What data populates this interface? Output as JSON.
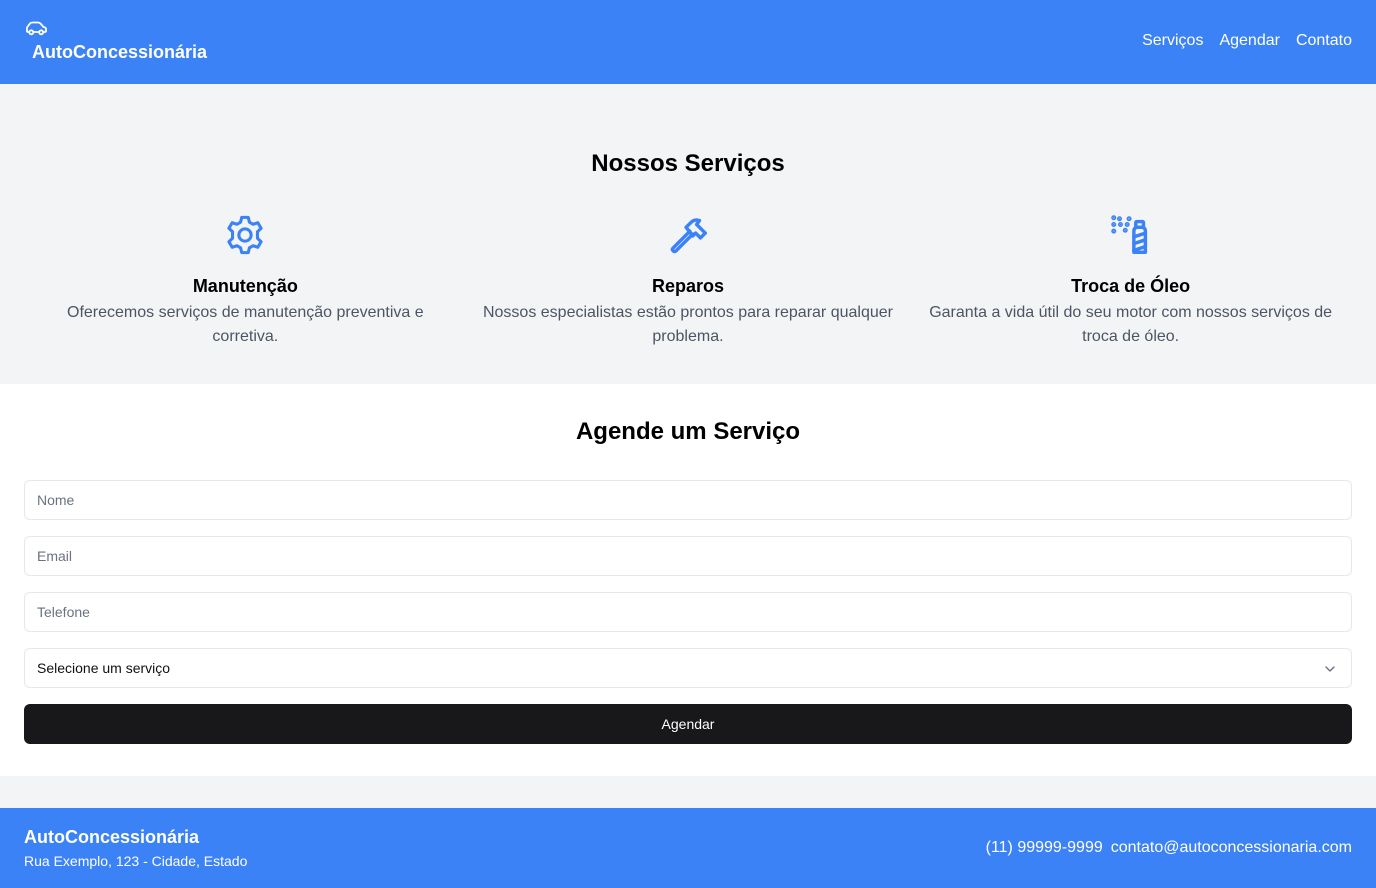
{
  "header": {
    "brand_icon": "car-icon",
    "brand_name": "AutoConcessionária",
    "nav": [
      "Serviços",
      "Agendar",
      "Contato"
    ]
  },
  "services": {
    "title": "Nossos Serviços",
    "items": [
      {
        "icon": "gear-icon",
        "title": "Manutenção",
        "description": "Oferecemos serviços de manutenção preventiva e corretiva."
      },
      {
        "icon": "hammer-icon",
        "title": "Reparos",
        "description": "Nossos especialistas estão prontos para reparar qualquer problema."
      },
      {
        "icon": "spray-can-icon",
        "title": "Troca de Óleo",
        "description": "Garanta a vida útil do seu motor com nossos serviços de troca de óleo."
      }
    ]
  },
  "booking": {
    "title": "Agende um Serviço",
    "name_placeholder": "Nome",
    "email_placeholder": "Email",
    "phone_placeholder": "Telefone",
    "service_select_value": "Selecione um serviço",
    "submit_label": "Agendar"
  },
  "footer": {
    "brand_name": "AutoConcessionária",
    "address": "Rua Exemplo, 123 - Cidade, Estado",
    "phone": "(11) 99999-9999",
    "email": "contato@autoconcessionaria.com"
  },
  "colors": {
    "primary": "#3b82f6",
    "button": "#18181b",
    "section_bg": "#f3f4f6",
    "text_muted": "#4b5563"
  }
}
